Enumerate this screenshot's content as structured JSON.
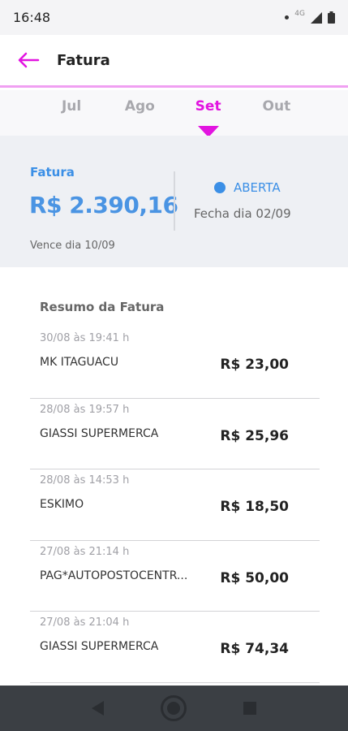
{
  "status_bar": {
    "time": "16:48",
    "network": "4G"
  },
  "header": {
    "title": "Fatura",
    "accent_color": "#e214e0"
  },
  "months": [
    {
      "label": "Jul",
      "active": false
    },
    {
      "label": "Ago",
      "active": false
    },
    {
      "label": "Set",
      "active": true
    },
    {
      "label": "Out",
      "active": false
    }
  ],
  "summary": {
    "label": "Fatura",
    "amount": "R$ 2.390,16",
    "due": "Vence dia 10/09",
    "status": "ABERTA",
    "close": "Fecha dia 02/09",
    "status_color": "#3b8fe6"
  },
  "list": {
    "title": "Resumo da Fatura",
    "items": [
      {
        "date": "30/08  às  19:41 h",
        "name": "MK ITAGUACU",
        "value": "R$ 23,00"
      },
      {
        "date": "28/08  às  19:57 h",
        "name": "GIASSI SUPERMERCA",
        "value": "R$ 25,96"
      },
      {
        "date": "28/08  às  14:53 h",
        "name": "ESKIMO",
        "value": "R$ 18,50"
      },
      {
        "date": "27/08  às  21:14 h",
        "name": "PAG*AUTOPOSTOCENTR...",
        "value": "R$ 50,00"
      },
      {
        "date": "27/08  às  21:04 h",
        "name": "GIASSI SUPERMERCA",
        "value": "R$ 74,34"
      }
    ]
  }
}
